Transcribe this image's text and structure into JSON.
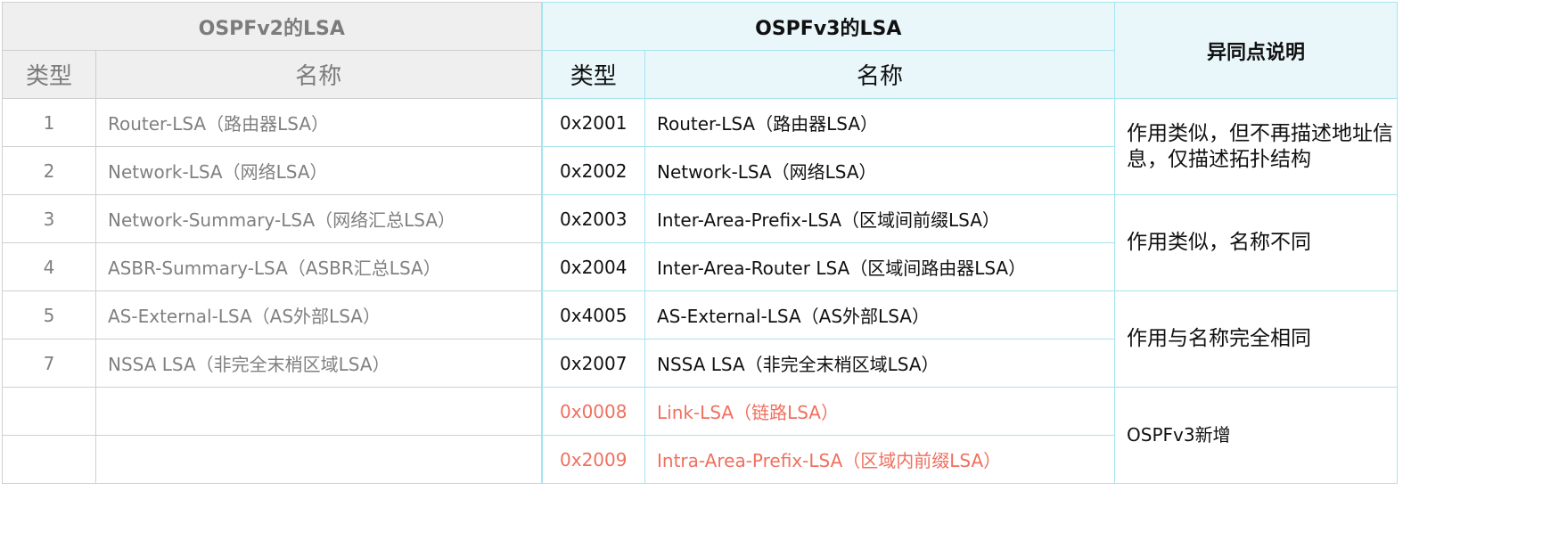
{
  "header": {
    "v2_title": "OSPFv2的LSA",
    "v3_title": "OSPFv3的LSA",
    "notes_title": "异同点说明",
    "v2_type_label": "类型",
    "v2_name_label": "名称",
    "v3_type_label": "类型",
    "v3_name_label": "名称"
  },
  "rows": [
    {
      "v2_type": "1",
      "v2_name": "Router-LSA（路由器LSA）",
      "v3_code": "0x2001",
      "v3_name": "Router-LSA（路由器LSA）"
    },
    {
      "v2_type": "2",
      "v2_name": "Network-LSA（网络LSA）",
      "v3_code": "0x2002",
      "v3_name": "Network-LSA（网络LSA）"
    },
    {
      "v2_type": "3",
      "v2_name": "Network-Summary-LSA（网络汇总LSA）",
      "v3_code": "0x2003",
      "v3_name": "Inter-Area-Prefix-LSA（区域间前缀LSA）"
    },
    {
      "v2_type": "4",
      "v2_name": "ASBR-Summary-LSA（ASBR汇总LSA）",
      "v3_code": "0x2004",
      "v3_name": "Inter-Area-Router LSA（区域间路由器LSA）"
    },
    {
      "v2_type": "5",
      "v2_name": "AS-External-LSA（AS外部LSA）",
      "v3_code": "0x4005",
      "v3_name": "AS-External-LSA（AS外部LSA）"
    },
    {
      "v2_type": "7",
      "v2_name": "NSSA LSA（非完全末梢区域LSA）",
      "v3_code": "0x2007",
      "v3_name": "NSSA LSA（非完全末梢区域LSA）"
    },
    {
      "v2_type": "",
      "v2_name": "",
      "v3_code": "0x0008",
      "v3_name": "Link-LSA（链路LSA）"
    },
    {
      "v2_type": "",
      "v2_name": "",
      "v3_code": "0x2009",
      "v3_name": "Intra-Area-Prefix-LSA（区域内前缀LSA）"
    }
  ],
  "notes": [
    "作用类似，但不再描述地址信息，仅描述拓扑结构",
    "作用类似，名称不同",
    "作用与名称完全相同",
    "OSPFv3新增"
  ],
  "colors": {
    "new_lsa": "#f0705f",
    "v3_border": "#a6e4ef",
    "v2_text": "#808080"
  }
}
